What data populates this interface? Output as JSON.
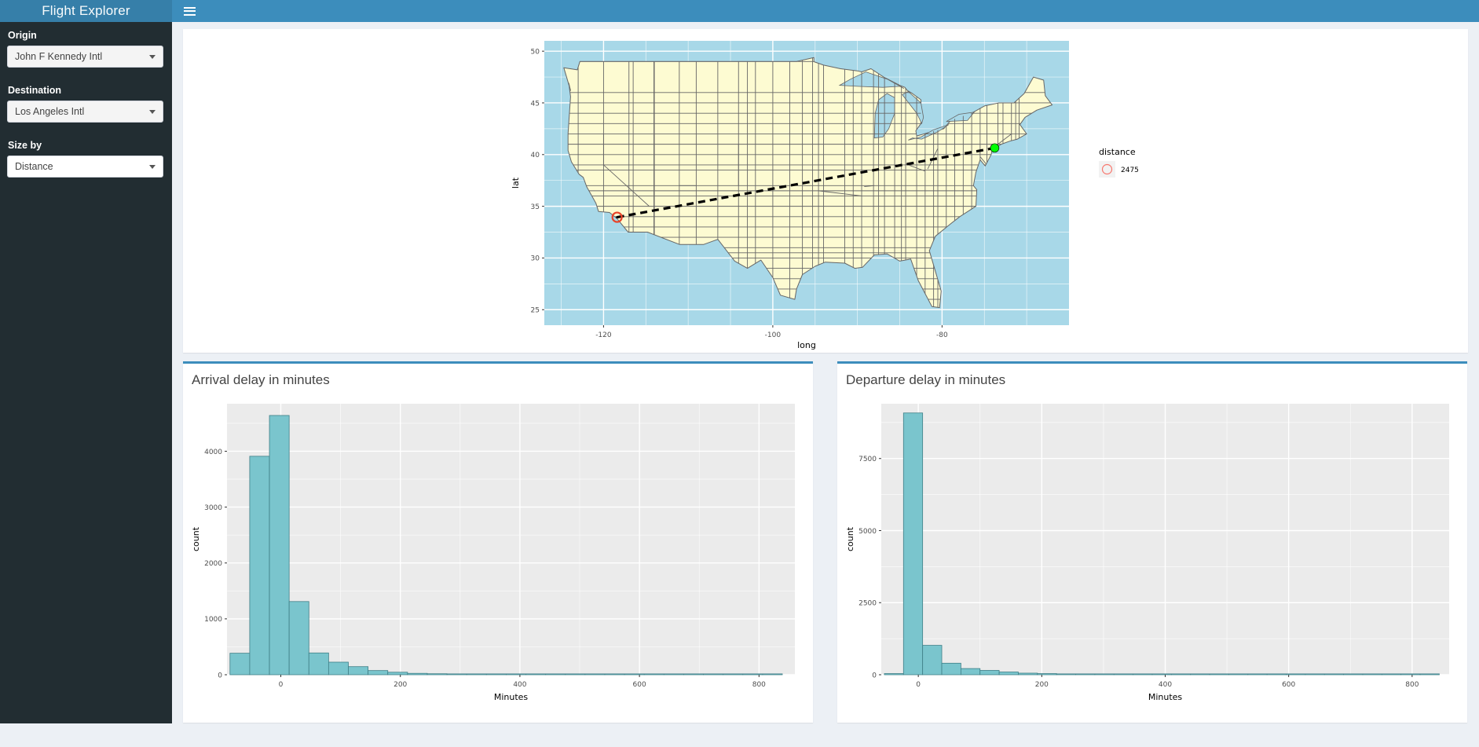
{
  "header": {
    "app_title": "Flight Explorer",
    "menu_icon": "hamburger-icon"
  },
  "sidebar": {
    "controls": [
      {
        "label": "Origin",
        "value": "John F Kennedy Intl"
      },
      {
        "label": "Destination",
        "value": "Los Angeles Intl"
      },
      {
        "label": "Size by",
        "value": "Distance"
      }
    ]
  },
  "boxes": {
    "map_title": "",
    "arrival_title": "Arrival delay in minutes",
    "departure_title": "Departure delay in minutes"
  },
  "colors": {
    "header_logo": "#367fa9",
    "header_nav": "#3c8dbc",
    "sidebar_bg": "#222d32",
    "box_accent": "#3c8dbc",
    "ocean": "#a8d8e8",
    "land": "#fdfbd2",
    "state_border": "#666666",
    "route_line": "#000000",
    "origin_marker": "#00ff00",
    "dest_marker": "#e8442a",
    "bar_fill": "#7ac5cd",
    "bar_stroke": "#3f7f87",
    "panel_bg": "#ebebeb",
    "grid": "#ffffff"
  },
  "chart_data": [
    {
      "type": "map",
      "title": "",
      "xlabel": "long",
      "ylabel": "lat",
      "xticks": [
        -120,
        -100,
        -80
      ],
      "yticks": [
        25,
        30,
        35,
        40,
        45,
        50
      ],
      "xlim": [
        -127,
        -65
      ],
      "ylim": [
        23.5,
        51
      ],
      "grid": true,
      "legend": {
        "position": "right",
        "title": "distance",
        "entries": [
          {
            "label": "2475",
            "shape": "open-circle"
          }
        ]
      },
      "annotations": [
        {
          "name": "route-line",
          "style": "dashed",
          "from": [
            -118.4,
            33.94
          ],
          "to": [
            -73.78,
            40.64
          ]
        },
        {
          "name": "origin-point",
          "label": "John F Kennedy Intl",
          "lon": -73.78,
          "lat": 40.64,
          "color": "#00ff00"
        },
        {
          "name": "destination-point",
          "label": "Los Angeles Intl",
          "lon": -118.4,
          "lat": 33.94,
          "color": "#e8442a"
        }
      ]
    },
    {
      "type": "bar",
      "title": "Arrival delay in minutes",
      "xlabel": "Minutes",
      "ylabel": "count",
      "xticks": [
        0,
        200,
        400,
        600,
        800
      ],
      "yticks": [
        0,
        1000,
        2000,
        3000,
        4000
      ],
      "xlim": [
        -90,
        860
      ],
      "ylim": [
        0,
        4850
      ],
      "grid": true,
      "bin_width": 33,
      "bin_starts": [
        -85,
        -52,
        -19,
        14,
        47,
        80,
        113,
        146,
        179,
        212,
        245,
        278,
        311,
        344,
        377,
        410,
        443,
        476,
        509,
        542,
        575,
        608,
        641,
        674,
        707,
        740,
        773,
        806
      ],
      "values": [
        385,
        3910,
        4640,
        1310,
        390,
        225,
        145,
        75,
        45,
        25,
        18,
        12,
        9,
        7,
        6,
        5,
        4,
        3,
        3,
        2,
        2,
        2,
        1,
        1,
        1,
        1,
        1,
        1
      ]
    },
    {
      "type": "bar",
      "title": "Departure delay in minutes",
      "xlabel": "Minutes",
      "ylabel": "count",
      "xticks": [
        0,
        200,
        400,
        600,
        800
      ],
      "yticks": [
        0,
        2500,
        5000,
        7500
      ],
      "xlim": [
        -60,
        860
      ],
      "ylim": [
        0,
        9400
      ],
      "grid": true,
      "bin_width": 31,
      "bin_starts": [
        -55,
        -24,
        7,
        38,
        69,
        100,
        131,
        162,
        193,
        224,
        255,
        286,
        317,
        348,
        379,
        410,
        441,
        472,
        503,
        534,
        565,
        596,
        627,
        658,
        689,
        720,
        751,
        782,
        813
      ],
      "values": [
        40,
        9080,
        1020,
        400,
        215,
        150,
        95,
        55,
        40,
        28,
        20,
        15,
        12,
        10,
        8,
        6,
        5,
        4,
        4,
        3,
        3,
        2,
        2,
        2,
        1,
        1,
        1,
        1,
        1
      ]
    }
  ]
}
